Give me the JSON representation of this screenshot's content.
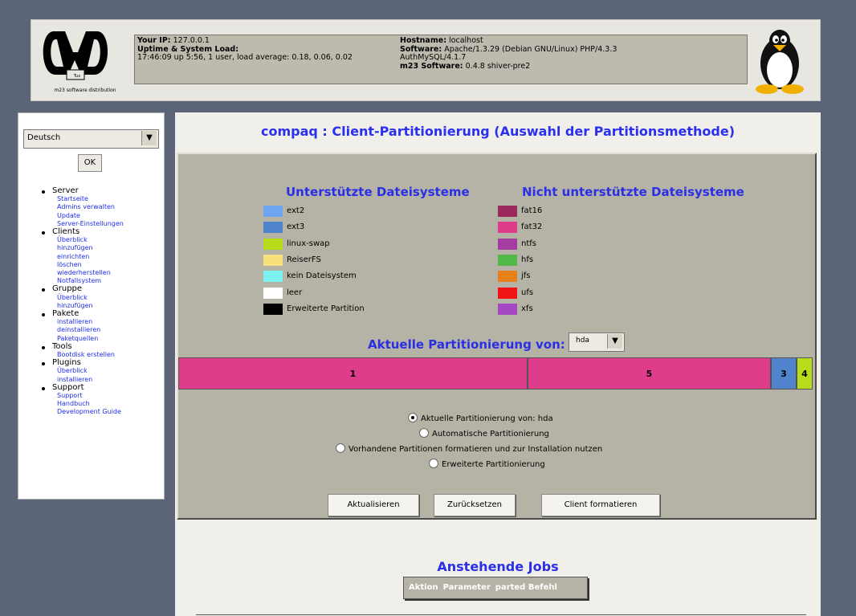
{
  "header": {
    "logo_caption": "m23 software distribution",
    "logo_badge": "Tux",
    "your_ip_label": "Your IP:",
    "your_ip": "127.0.0.1",
    "uptime_label": "Uptime & System Load:",
    "uptime": "17:46:09 up 5:56, 1 user, load average: 0.18, 0.06, 0.02",
    "hostname_label": "Hostname:",
    "hostname": "localhost",
    "software_label": "Software:",
    "software": "Apache/1.3.29 (Debian GNU/Linux) PHP/4.3.3 AuthMySQL/4.1.7",
    "m23_label": "m23 Software:",
    "m23_version": "0.4.8 shiver-pre2"
  },
  "sidebar": {
    "language": "Deutsch",
    "ok_label": "OK",
    "groups": [
      {
        "label": "Server",
        "items": [
          "Startseite",
          "Admins verwalten",
          "Update",
          "Server-Einstellungen"
        ]
      },
      {
        "label": "Clients",
        "items": [
          "Überblick",
          "hinzufügen",
          "einrichten",
          "löschen",
          "wiederherstellen",
          "Notfallsystem"
        ]
      },
      {
        "label": "Gruppe",
        "items": [
          "Überblick",
          "hinzufügen"
        ]
      },
      {
        "label": "Pakete",
        "items": [
          "installieren",
          "deinstallieren",
          "Paketquellen"
        ]
      },
      {
        "label": "Tools",
        "items": [
          "Bootdisk erstellen"
        ]
      },
      {
        "label": "Plugins",
        "items": [
          "Überblick",
          "installieren"
        ]
      },
      {
        "label": "Support",
        "items": [
          "Support",
          "Handbuch",
          "Development Guide"
        ]
      }
    ]
  },
  "main": {
    "title": "compaq : Client-Partitionierung (Auswahl der Partitionsmethode)",
    "supported_head": "Unterstützte Dateisysteme",
    "unsupported_head": "Nicht unterstützte Dateisysteme",
    "supported": [
      {
        "label": "ext2",
        "color": "#6fa4f0"
      },
      {
        "label": "ext3",
        "color": "#4f84cc"
      },
      {
        "label": "linux-swap",
        "color": "#b8dc1a"
      },
      {
        "label": "ReiserFS",
        "color": "#f8e17a"
      },
      {
        "label": "kein Dateisystem",
        "color": "#7cf3ee"
      },
      {
        "label": "leer",
        "color": "#ffffff"
      },
      {
        "label": "Erweiterte Partition",
        "color": "#000000"
      }
    ],
    "unsupported": [
      {
        "label": "fat16",
        "color": "#9b2a5c"
      },
      {
        "label": "fat32",
        "color": "#e03c8c"
      },
      {
        "label": "ntfs",
        "color": "#a43ea0"
      },
      {
        "label": "hfs",
        "color": "#52b848"
      },
      {
        "label": "jfs",
        "color": "#e8801a"
      },
      {
        "label": "ufs",
        "color": "#f01414"
      },
      {
        "label": "xfs",
        "color": "#a448c4"
      }
    ],
    "current_partitioning_label": "Aktuelle Partitionierung von:",
    "disk": "hda",
    "partitions": [
      {
        "label": "1",
        "color": "#e03c8c",
        "share": 0.551
      },
      {
        "label": "5",
        "color": "#e03c8c",
        "share": 0.384
      },
      {
        "label": "3",
        "color": "#4f84cc",
        "share": 0.04
      },
      {
        "label": "4",
        "color": "#b8dc1a",
        "share": 0.025
      }
    ],
    "options": [
      {
        "label": "Aktuelle Partitionierung von: hda",
        "selected": true
      },
      {
        "label": "Automatische Partitionierung",
        "selected": false
      },
      {
        "label": "Vorhandene Partitionen formatieren und zur Installation nutzen",
        "selected": false
      },
      {
        "label": "Erweiterte Partitionierung",
        "selected": false
      }
    ],
    "buttons": {
      "refresh": "Aktualisieren",
      "reset": "Zurücksetzen",
      "format": "Client formatieren"
    },
    "jobs_title": "Anstehende Jobs",
    "jobs_columns": [
      "Aktion",
      "Parameter",
      "parted Befehl"
    ]
  }
}
